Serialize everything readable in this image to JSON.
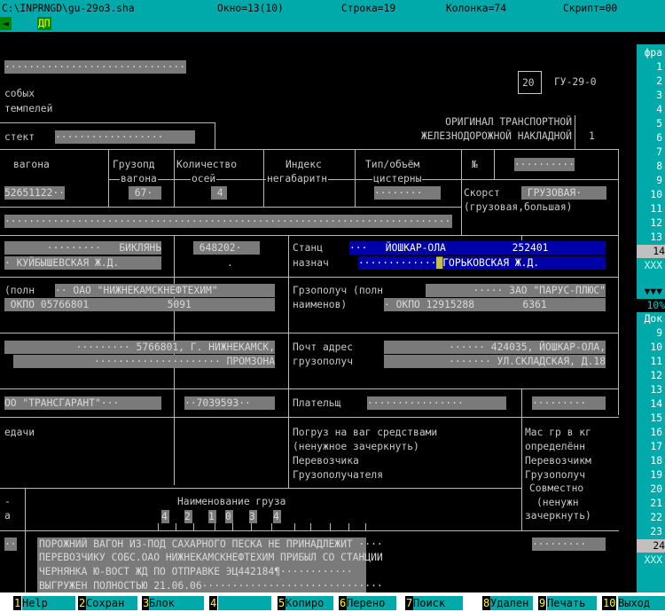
{
  "status": {
    "file": "C:\\INPRNGD\\gu-29o3.sha",
    "window": "Окно=13(10)",
    "row": "Строка=19",
    "column": "Колонка=74",
    "script": "Скрипт=00",
    "back_icon": "◄",
    "mode": "ДП"
  },
  "form": {
    "top_field": "·······························",
    "box_num": "20",
    "form_code": "ГУ-29-0",
    "stamps_1": "собых",
    "stamps_2": "темпелей",
    "stekt_label": "стект",
    "stekt_value": "··················",
    "original_1": "ОРИГИНАЛ ТРАНСПОРТНОЙ",
    "original_2": "ЖЕЛЕЗНОДОРОЖНОЙ НАКЛАДНОЙ",
    "copy_num": "1",
    "col_wagon": "вагона",
    "col_capacity_1": "Грузопд",
    "col_capacity_2": "вагона",
    "col_axles_1": "Количество",
    "col_axles_2": "осей",
    "col_index_1": "Индекс",
    "col_index_2": "негабаритн",
    "col_tank_1": "Тип/объём",
    "col_tank_2": "цистерны",
    "col_no": "№",
    "no_value": "··········",
    "wagon_value": "52651122··",
    "capacity_value": " 67·",
    "axles_value": " 4",
    "tank_value": "········",
    "speed_label": "Скорст",
    "speed_value": " ГРУЗОВАЯ·",
    "speed_hint": "(грузовая,большая)",
    "long_field": "··························································································",
    "dep_station_1": "·········   БИКЛЯНЬ",
    "dep_station_2": "· КУЙБЫШЕВСКАЯ Ж.Д.",
    "dep_code": " 648202·",
    "dep_code_2": ".",
    "dest_label_1": "Станц",
    "dest_label_2": "назнач",
    "dest_value_1": "···   ЙОШКАР-ОЛА           252401",
    "dest_value_2": "·············",
    "dest_value_3": "ГОРЬКОВСКАЯ Ж.Д.",
    "sender_label": "(полн",
    "sender_value_1": "·· ОАО \"НИЖНЕКАМСКНЕФТЕХИМ\"",
    "sender_value_2": " ОКПО 05766801             5091",
    "recv_label_1": "Грзополуч (полн",
    "recv_label_2": "наименов)",
    "recv_value_1": "····· ЗАО \"ПАРУС-ПЛЮС\"",
    "recv_value_2": "· ОКПО 12915288        6361",
    "sender_addr_1": "········· 5766801, Г. НИЖНЕКАМСК,",
    "sender_addr_2": "····················· ПРОМЗОНА",
    "recv_addr_label_1": "Почт адрес",
    "recv_addr_label_2": "грузополуч",
    "recv_addr_1": "······ 424035, ЙОШКАР-ОЛА,",
    "recv_addr_2": "······· УЛ.СКЛАДСКАЯ, Д.18",
    "forwarder": "ОО \"ТРАНСГАРАНТ\"···",
    "forwarder_code": "··7039593··",
    "payer_label": "Плательщ",
    "payer_value": "················",
    "payer_code": "·········",
    "transfer_label": "едачи",
    "loading_1": "Погруз на ваг средствами",
    "loading_2": "(ненужное зачеркнуть)",
    "loading_3": "Перевозчика",
    "loading_4": "Грузополучателя",
    "mass_1": "Мас гр в кг",
    "mass_2": "определённ",
    "mass_3": "Перевозчикм",
    "mass_4": "Грузополуч",
    "mass_5": "Совместно",
    "mass_6": "(ненужн",
    "mass_7": "зачеркнуть)",
    "left_col_1": "-",
    "left_col_2": "а",
    "left_col_val": "··",
    "cargo_title": "Наименование груза",
    "cargo_code": [
      "4",
      "2",
      "1",
      "0",
      "3",
      "4"
    ],
    "cargo_text": [
      "ПОРОЖНИЙ ВАГОН ИЗ-ПОД САХАРНОГО ПЕСКА НЕ ПРИНАДЛЕЖИТ ····",
      "ПЕРЕВОЗЧИКУ СОБС.ОАО НИЖНЕКАМСКНЕФТЕХИМ ПРИБЫЛ СО СТАНЦИИ",
      "ЧЕРНЯНКА Ю-ВОСТ ЖД ПО ОТПРАВКЕ ЭЦ442184¶············",
      "ВЫГРУЖЕН ПОЛНОСТЬЮ 21.06.06······························"
    ],
    "mass_value": "·········"
  },
  "sidebar": {
    "head1": "фра",
    "nums1": [
      "1",
      "2",
      "3",
      "4",
      "5",
      "6",
      "7",
      "8",
      "9",
      "10",
      "11",
      "12",
      "13"
    ],
    "current1": "14",
    "marker": "XXX",
    "arrows": "▼▼▼",
    "percent": "10%",
    "head2": "Док",
    "nums2": [
      "9",
      "10",
      "11",
      "12",
      "13",
      "14",
      "15",
      "16",
      "17",
      "18",
      "19",
      "20",
      "21",
      "22",
      "23"
    ],
    "current2": "24"
  },
  "keys": [
    {
      "n": "1",
      "l": "Help"
    },
    {
      "n": "2",
      "l": "Сохран"
    },
    {
      "n": "3",
      "l": "Блок"
    },
    {
      "n": "4",
      "l": ""
    },
    {
      "n": "5",
      "l": "Копиро"
    },
    {
      "n": "6",
      "l": "Перено"
    },
    {
      "n": "7",
      "l": "Поиск"
    },
    {
      "n": "8",
      "l": "Удален"
    },
    {
      "n": "9",
      "l": "Печать"
    },
    {
      "n": "10",
      "l": "Выход"
    }
  ]
}
